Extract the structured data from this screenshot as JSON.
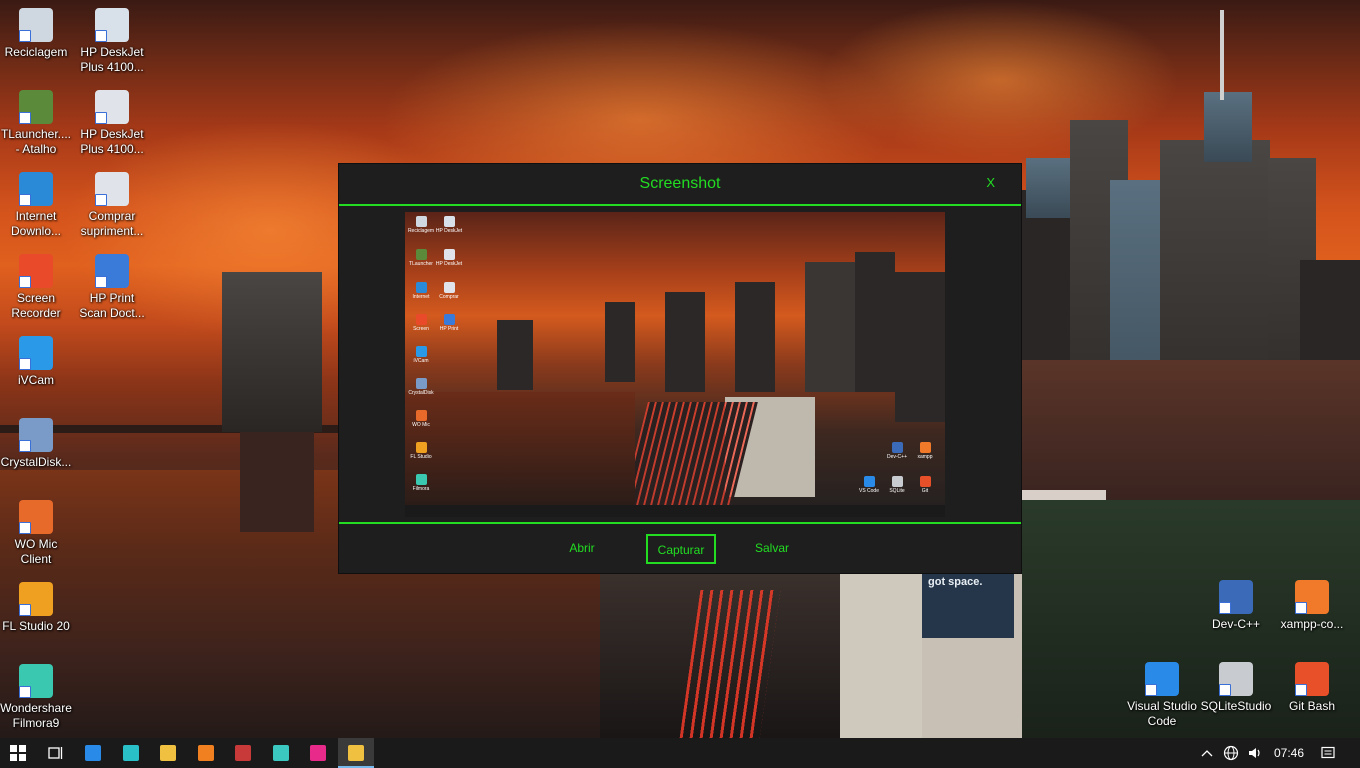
{
  "desktop": {
    "icons_left": [
      {
        "name": "icon-reciclagem",
        "label": "Reciclagem",
        "glyph": "recycle-bin-icon",
        "color": "#cfd8e0"
      },
      {
        "name": "icon-tlauncher",
        "label": "TLauncher....\n- Atalho",
        "glyph": "minecraft-icon",
        "color": "#5a8a3a"
      },
      {
        "name": "icon-internet-download",
        "label": "Internet\nDownlo...",
        "glyph": "idm-icon",
        "color": "#2a8ad8"
      },
      {
        "name": "icon-screen-recorder",
        "label": "Screen\nRecorder",
        "glyph": "record-icon",
        "color": "#e84a2a"
      },
      {
        "name": "icon-ivcam",
        "label": "iVCam",
        "glyph": "camera-icon",
        "color": "#2a9ae8"
      },
      {
        "name": "icon-crystaldisk",
        "label": "CrystalDisk...",
        "glyph": "disk-icon",
        "color": "#7a9ac8"
      },
      {
        "name": "icon-wo-mic",
        "label": "WO Mic\nClient",
        "glyph": "microphone-icon",
        "color": "#e86a2a"
      },
      {
        "name": "icon-fl-studio",
        "label": "FL Studio 20",
        "glyph": "fl-studio-icon",
        "color": "#f0a020"
      },
      {
        "name": "icon-filmora",
        "label": "Wondershare\nFilmora9",
        "glyph": "filmora-icon",
        "color": "#3ac8b0"
      }
    ],
    "icons_second": [
      {
        "name": "icon-hp-deskjet-1",
        "label": "HP DeskJet\nPlus 4100...",
        "glyph": "printer-icon",
        "color": "#d8e0ea"
      },
      {
        "name": "icon-hp-deskjet-2",
        "label": "HP DeskJet\nPlus 4100...",
        "glyph": "printer-icon",
        "color": "#e0e4ea"
      },
      {
        "name": "icon-comprar",
        "label": "Comprar\nsupriment...",
        "glyph": "printer-cart-icon",
        "color": "#e0e4ea"
      },
      {
        "name": "icon-hp-print-scan",
        "label": "HP Print\nScan Doct...",
        "glyph": "scan-icon",
        "color": "#3a7ad8"
      }
    ],
    "icons_right": [
      {
        "name": "icon-dev-cpp",
        "label": "Dev-C++",
        "glyph": "dev-cpp-icon",
        "color": "#3a6ab8"
      },
      {
        "name": "icon-xampp",
        "label": "xampp-co...",
        "glyph": "xampp-icon",
        "color": "#f07a2a"
      },
      {
        "name": "icon-vscode",
        "label": "Visual Studio\nCode",
        "glyph": "vscode-icon",
        "color": "#2a8ae8"
      },
      {
        "name": "icon-sqlitestudio",
        "label": "SQLiteStudio",
        "glyph": "database-icon",
        "color": "#c8ccd0"
      },
      {
        "name": "icon-git-bash",
        "label": "Git Bash",
        "glyph": "git-icon",
        "color": "#e8502a"
      }
    ],
    "billboard_text": "got space."
  },
  "app": {
    "title": "Screenshot",
    "close_label": "X",
    "buttons": {
      "open": "Abrir",
      "capture": "Capturar",
      "save": "Salvar"
    },
    "accent_color": "#22dd22",
    "background_color": "#1e1e1e"
  },
  "taskbar": {
    "items": [
      {
        "name": "taskbar-start",
        "glyph": "windows-start-icon",
        "color": "#ffffff"
      },
      {
        "name": "taskbar-task-view",
        "glyph": "task-view-icon",
        "color": "#ffffff"
      },
      {
        "name": "taskbar-vscode",
        "glyph": "vscode-icon",
        "color": "#2a8ae8"
      },
      {
        "name": "taskbar-edge",
        "glyph": "edge-icon",
        "color": "#2ac0c8"
      },
      {
        "name": "taskbar-file-explorer",
        "glyph": "folder-icon",
        "color": "#f0c040"
      },
      {
        "name": "taskbar-avast",
        "glyph": "avast-icon",
        "color": "#f08020"
      },
      {
        "name": "taskbar-access",
        "glyph": "access-icon",
        "color": "#c83a3a"
      },
      {
        "name": "taskbar-stack",
        "glyph": "stack-icon",
        "color": "#3ac8c0"
      },
      {
        "name": "taskbar-media",
        "glyph": "media-icon",
        "color": "#e82a8a"
      },
      {
        "name": "taskbar-screenshot-app",
        "glyph": "screenshot-app-icon",
        "color": "#f0c040"
      }
    ],
    "clock": "07:46",
    "tray_icons": [
      "chevron-up-icon",
      "network-icon",
      "volume-icon"
    ],
    "notification_icon": "notification-icon"
  }
}
